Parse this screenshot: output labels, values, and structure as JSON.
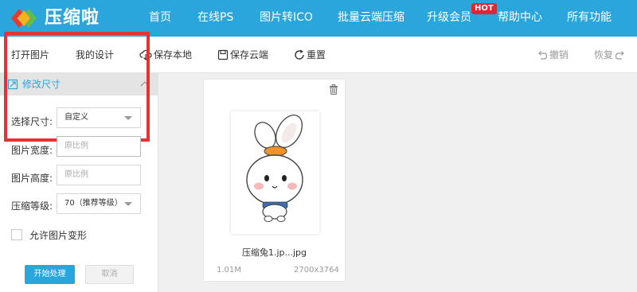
{
  "brand": {
    "name": "压缩啦"
  },
  "nav": {
    "items": [
      "首页",
      "在线PS",
      "图片转ICO",
      "批量云端压缩",
      "升级会员",
      "帮助中心",
      "所有功能"
    ],
    "hot_badge": "HOT"
  },
  "toolbar": {
    "open": "打开图片",
    "my_design": "我的设计",
    "save_local": "保存本地",
    "save_cloud": "保存云端",
    "reset": "重置",
    "undo": "撤销",
    "redo": "恢复"
  },
  "panel": {
    "title": "修改尺寸",
    "size_label": "选择尺寸:",
    "size_value": "自定义",
    "width_label": "图片宽度:",
    "width_placeholder": "原比例",
    "height_label": "图片高度:",
    "height_placeholder": "原比例",
    "quality_label": "压缩等级:",
    "quality_value": "70（推荐等级）",
    "allow_deform": "允许图片变形",
    "allow_deform_checked": false,
    "start_button": "开始处理",
    "cancel_button": "取消"
  },
  "file": {
    "name": "压缩兔1.jp...jpg",
    "size": "1.01M",
    "dimensions": "2700x3764"
  },
  "colors": {
    "accent": "#2aa6dc",
    "highlight": "#e83232",
    "hot": "#e3262e"
  }
}
